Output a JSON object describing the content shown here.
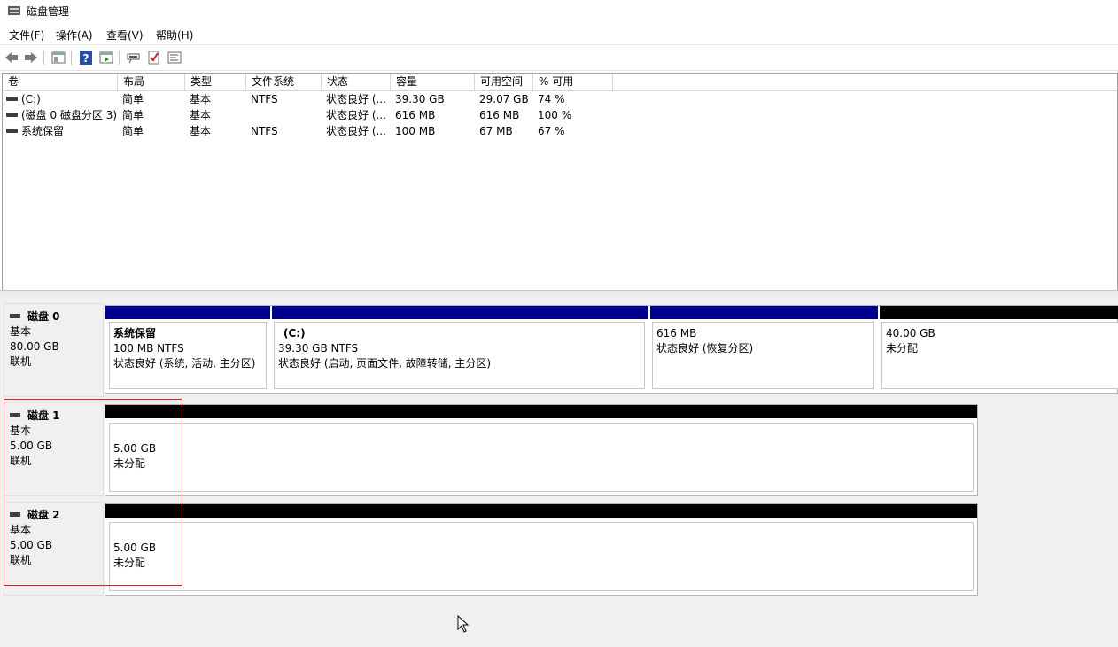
{
  "window": {
    "title": "磁盘管理"
  },
  "menu": [
    "文件(F)",
    "操作(A)",
    "查看(V)",
    "帮助(H)"
  ],
  "toolbar": [
    "back-icon",
    "forward-icon",
    "console-tree-icon",
    "help-icon",
    "properties-icon",
    "connect-icon",
    "check-icon",
    "console-icon"
  ],
  "columns": [
    "卷",
    "布局",
    "类型",
    "文件系统",
    "状态",
    "容量",
    "可用空间",
    "% 可用"
  ],
  "volumes": [
    [
      "(C:)",
      "简单",
      "基本",
      "NTFS",
      "状态良好 (...",
      "39.30 GB",
      "29.07 GB",
      "74 %"
    ],
    [
      "(磁盘 0 磁盘分区 3)",
      "简单",
      "基本",
      "",
      "状态良好 (...",
      "616 MB",
      "616 MB",
      "100 %"
    ],
    [
      "系统保留",
      "简单",
      "基本",
      "NTFS",
      "状态良好 (...",
      "100 MB",
      "67 MB",
      "67 %"
    ]
  ],
  "disks": [
    {
      "name": "磁盘 0",
      "type": "基本",
      "size": "80.00 GB",
      "status": "联机",
      "partitions": [
        {
          "title": "系统保留",
          "line1": "100 MB NTFS",
          "line2": "状态良好 (系统, 活动, 主分区)"
        },
        {
          "title": "(C:)",
          "line1": "39.30 GB NTFS",
          "line2": "状态良好 (启动, 页面文件, 故障转储, 主分区)"
        },
        {
          "title": "",
          "line1": "616 MB",
          "line2": "状态良好 (恢复分区)"
        },
        {
          "title": "",
          "line1": "40.00 GB",
          "line2": "未分配"
        }
      ]
    },
    {
      "name": "磁盘 1",
      "type": "基本",
      "size": "5.00 GB",
      "status": "联机",
      "partitions": [
        {
          "title": "",
          "line1": "5.00 GB",
          "line2": "未分配"
        }
      ]
    },
    {
      "name": "磁盘 2",
      "type": "基本",
      "size": "5.00 GB",
      "status": "联机",
      "partitions": [
        {
          "title": "",
          "line1": "5.00 GB",
          "line2": "未分配"
        }
      ]
    }
  ],
  "colors": {
    "primary_partition": "#00008b",
    "unallocated": "#000000",
    "highlight": "#e02020"
  }
}
